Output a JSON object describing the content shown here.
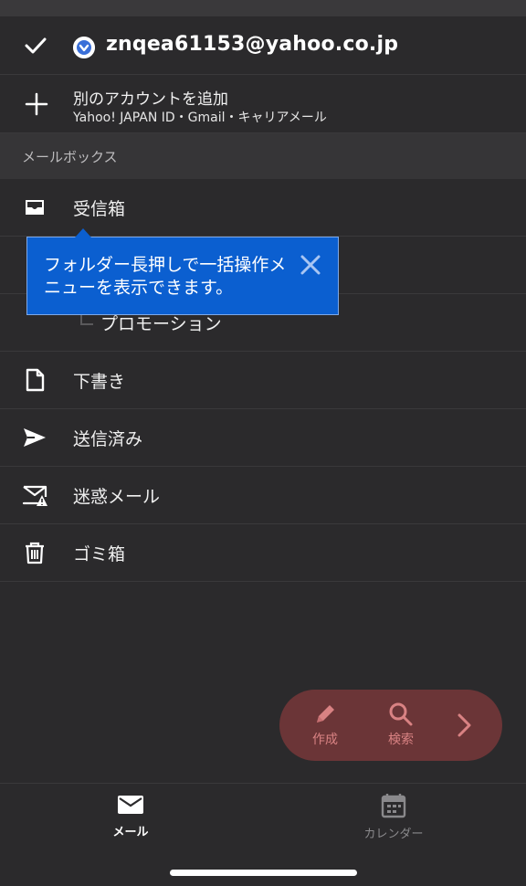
{
  "account": {
    "email": "znqea61153@yahoo.co.jp",
    "selected": true
  },
  "add_account": {
    "title": "別のアカウントを追加",
    "subtitle": "Yahoo! JAPAN ID・Gmail・キャリアメール"
  },
  "mailbox_section": {
    "header": "メールボックス"
  },
  "folders": [
    {
      "label": "受信箱",
      "icon": "inbox-icon"
    },
    {
      "label": "プロモーション",
      "icon": "branch-icon",
      "sub": true
    },
    {
      "label": "下書き",
      "icon": "draft-icon"
    },
    {
      "label": "送信済み",
      "icon": "send-icon"
    },
    {
      "label": "迷惑メール",
      "icon": "spam-icon"
    },
    {
      "label": "ゴミ箱",
      "icon": "trash-icon"
    }
  ],
  "tooltip": {
    "text": "フォルダー長押しで一括操作メニューを表示できます。"
  },
  "fab": {
    "compose_label": "作成",
    "search_label": "検索",
    "color": "#6b3537",
    "accent": "#d98283"
  },
  "bottom_nav": {
    "tabs": [
      {
        "label": "メール",
        "icon": "mail-icon",
        "active": true
      },
      {
        "label": "カレンダー",
        "icon": "calendar-icon",
        "active": false
      }
    ]
  },
  "colors": {
    "background": "#2b2a2c",
    "tooltip": "#0b5fd0"
  }
}
